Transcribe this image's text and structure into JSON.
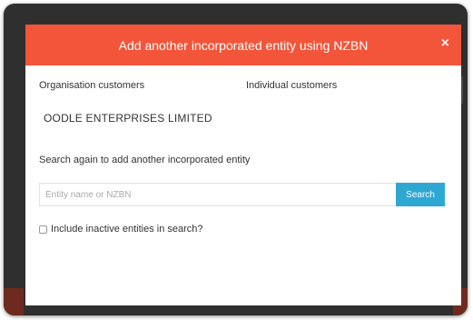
{
  "modal": {
    "title": "Add another incorporated entity using NZBN",
    "close_label": "×"
  },
  "tabs": [
    {
      "label": "Organisation customers"
    },
    {
      "label": "Individual customers"
    }
  ],
  "entity": {
    "name": "OODLE ENTERPRISES LIMITED"
  },
  "search": {
    "heading": "Search again to add another incorporated entity",
    "placeholder": "Entity name or NZBN",
    "value": "",
    "button_label": "Search"
  },
  "options": {
    "include_inactive_label": "Include inactive entities in search?",
    "include_inactive_checked": false
  },
  "colors": {
    "header": "#f2553a",
    "search_button": "#2ea8d2",
    "frame": "#2f2f2f"
  }
}
